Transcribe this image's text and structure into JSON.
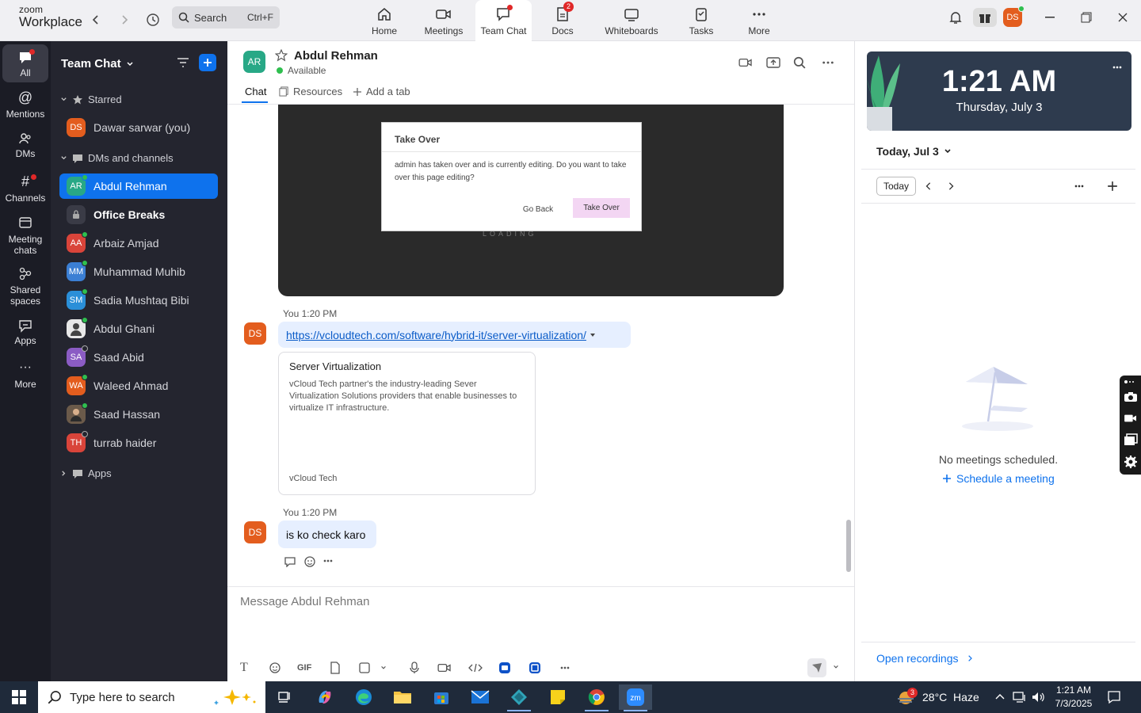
{
  "app": {
    "logo_line1": "zoom",
    "logo_line2": "Workplace",
    "search_placeholder": "Search",
    "search_shortcut": "Ctrl+F",
    "accent": "#0e72ed"
  },
  "topnav": {
    "tabs": [
      {
        "label": "Home",
        "icon": "home-icon"
      },
      {
        "label": "Meetings",
        "icon": "video-icon"
      },
      {
        "label": "Team Chat",
        "icon": "chat-icon",
        "active": true
      },
      {
        "label": "Docs",
        "icon": "docs-icon",
        "badge": "2"
      },
      {
        "label": "Whiteboards",
        "icon": "whiteboard-icon"
      },
      {
        "label": "Tasks",
        "icon": "tasks-icon"
      },
      {
        "label": "More",
        "icon": "more-icon"
      }
    ],
    "user_initials": "DS"
  },
  "rail": {
    "items": [
      {
        "label": "All",
        "icon": "chat-bubble-icon"
      },
      {
        "label": "Mentions",
        "icon": "at-icon"
      },
      {
        "label": "DMs",
        "icon": "people-icon"
      },
      {
        "label": "Channels",
        "icon": "hash-icon"
      },
      {
        "label": "Meeting chats",
        "icon": "calendar-icon"
      },
      {
        "label": "Shared spaces",
        "icon": "shared-icon"
      },
      {
        "label": "Apps",
        "icon": "apps-icon"
      },
      {
        "label": "More",
        "icon": "more-icon"
      }
    ]
  },
  "sidebar": {
    "title": "Team Chat",
    "starred_label": "Starred",
    "dms_label": "DMs and channels",
    "apps_label": "Apps",
    "starred": [
      {
        "initials": "DS",
        "name": "Dawar sarwar (you)",
        "color": "#e35d1e"
      }
    ],
    "contacts": [
      {
        "initials": "AR",
        "name": "Abdul Rehman",
        "color": "#28a886",
        "status": "#2fbf4f"
      },
      {
        "initials": "",
        "name": "Office Breaks",
        "color": "#3a3b46"
      },
      {
        "initials": "AA",
        "name": "Arbaiz Amjad",
        "color": "#d9443a",
        "status": "#2fbf4f"
      },
      {
        "initials": "MM",
        "name": "Muhammad Muhib",
        "color": "#3b7fd4",
        "status": "#2fbf4f"
      },
      {
        "initials": "SM",
        "name": "Sadia Mushtaq Bibi",
        "color": "#2a8fd8",
        "status": "#2fbf4f"
      },
      {
        "initials": "",
        "name": "Abdul Ghani",
        "color": "#e8e8e8",
        "status": "#2fbf4f"
      },
      {
        "initials": "SA",
        "name": "Saad Abid",
        "color": "#8b5cc4",
        "status": "#24252f"
      },
      {
        "initials": "WA",
        "name": "Waleed Ahmad",
        "color": "#e35d1e",
        "status": "#2fbf4f"
      },
      {
        "initials": "",
        "name": "Saad Hassan",
        "color": "#6b5a4a",
        "status": "#2fbf4f"
      },
      {
        "initials": "TH",
        "name": "turrab haider",
        "color": "#d9443a",
        "status": "#24252f"
      }
    ]
  },
  "chat": {
    "contact_initials": "AR",
    "contact_name": "Abdul Rehman",
    "contact_status": "Available",
    "tabs": {
      "chat": "Chat",
      "resources": "Resources",
      "add": "Add a tab"
    },
    "dialog": {
      "title": "Take Over",
      "body": "admin has taken over and is currently editing. Do you want to take over this page editing?",
      "go_back": "Go Back",
      "take_over": "Take Over",
      "loading": "LOADING"
    },
    "messages": [
      {
        "initials": "DS",
        "meta": "You 1:20 PM",
        "link": "https://vcloudtech.com/software/hybrid-it/server-virtualization/"
      },
      {
        "initials": "DS",
        "meta": "You 1:20 PM",
        "text": "is ko check karo"
      }
    ],
    "card": {
      "title": "Server Virtualization",
      "desc": "vCloud Tech partner's the industry-leading Sever Virtualization Solutions providers that enable businesses to virtualize IT infrastructure.",
      "source": "vCloud Tech"
    },
    "composer_placeholder": "Message Abdul Rehman",
    "gif_label": "GIF"
  },
  "right": {
    "time": "1:21 AM",
    "date": "Thursday, July 3",
    "day_select": "Today, Jul 3",
    "today_btn": "Today",
    "no_meetings": "No meetings scheduled.",
    "schedule": "Schedule a meeting",
    "recordings": "Open recordings"
  },
  "taskbar": {
    "search_placeholder": "Type here to search",
    "weather": "28°C  Haze",
    "weather_badge": "3",
    "time": "1:21 AM",
    "date": "7/3/2025"
  }
}
